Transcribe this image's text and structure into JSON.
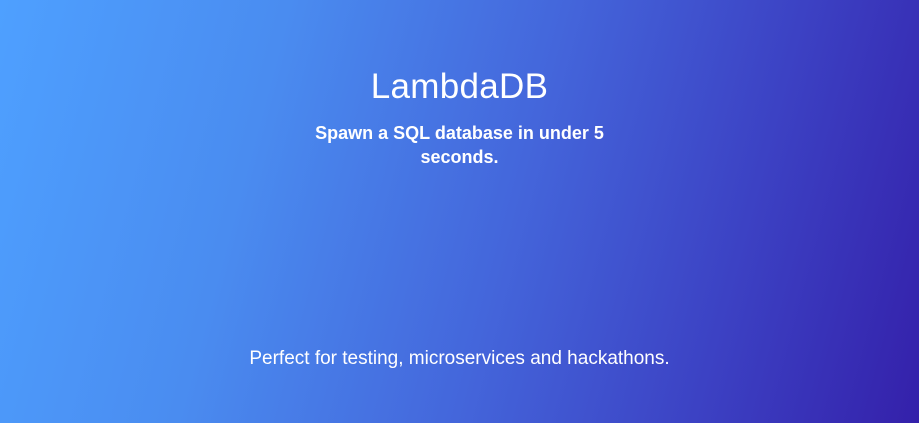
{
  "hero": {
    "title": "LambdaDB",
    "tagline": "Spawn a SQL database in under 5 seconds.",
    "description": "Perfect for testing, microservices and hackathons.",
    "gradient_start": "#4ea0ff",
    "gradient_end": "#3420aa"
  }
}
